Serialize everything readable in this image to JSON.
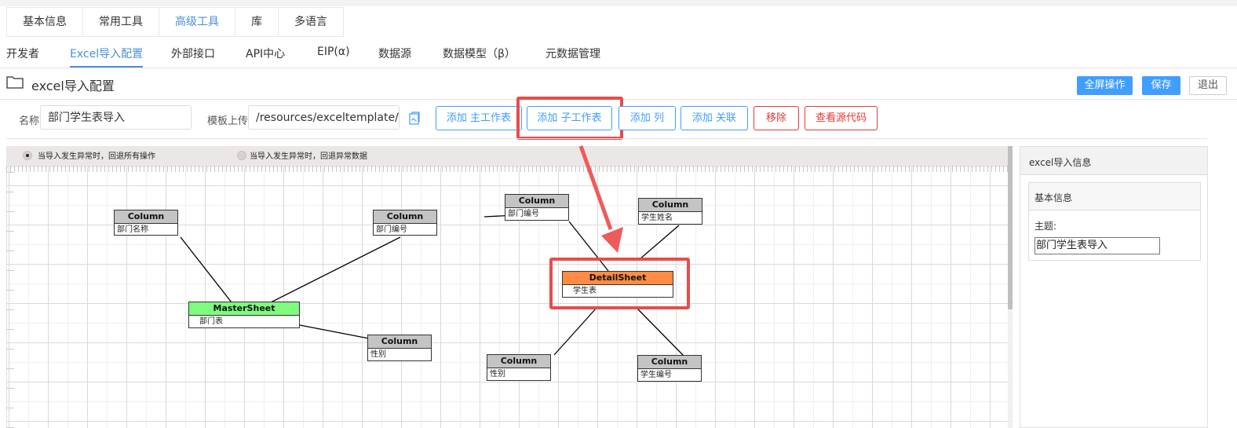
{
  "tabs_primary": [
    "基本信息",
    "常用工具",
    "高级工具",
    "库",
    "多语言"
  ],
  "tabs_secondary": [
    "开发者",
    "Excel导入配置",
    "外部接口",
    "API中心",
    "EIP(α)",
    "数据源",
    "数据模型（β）",
    "元数据管理"
  ],
  "header": {
    "title": "excel导入配置",
    "fullscreen_label": "全屏操作",
    "save_label": "保存",
    "exit_label": "退出"
  },
  "form": {
    "name_label": "名称",
    "name_value": "部门学生表导入",
    "template_label": "模板上传",
    "template_value": "/resources/exceltemplate/部门学生表.xlsx"
  },
  "actions": {
    "add_main_sheet": "添加 主工作表",
    "add_sub_sheet": "添加 子工作表",
    "add_column": "添加 列",
    "add_relation": "添加 关联",
    "remove": "移除",
    "view_source": "查看源代码"
  },
  "canvas": {
    "option_rollback_all": "当导入发生异常时，回退所有操作",
    "option_rollback_error": "当导入发生异常时，回退异常数据",
    "nodes": {
      "col_dept_name": {
        "title": "Column",
        "body": "部门名称"
      },
      "col_dept_no_left": {
        "title": "Column",
        "body": "部门编号"
      },
      "master": {
        "title": "MasterSheet",
        "body": "部门表"
      },
      "col_gender_left": {
        "title": "Column",
        "body": "性别"
      },
      "col_dept_no_right": {
        "title": "Column",
        "body": "部门编号"
      },
      "col_student_name": {
        "title": "Column",
        "body": "学生姓名"
      },
      "detail": {
        "title": "DetailSheet",
        "body": "学生表"
      },
      "col_gender_right": {
        "title": "Column",
        "body": "性别"
      },
      "col_student_no": {
        "title": "Column",
        "body": "学生编号"
      }
    }
  },
  "side_panel": {
    "title": "excel导入信息",
    "section_title": "基本信息",
    "subject_label": "主题:",
    "subject_value": "部门学生表导入"
  },
  "colors": {
    "accent": "#409eff",
    "danger": "#e53935",
    "highlight": "#e84c4c",
    "master_header": "#7dfc7d",
    "detail_header": "#ff8c42",
    "column_header": "#c4c4c4"
  }
}
